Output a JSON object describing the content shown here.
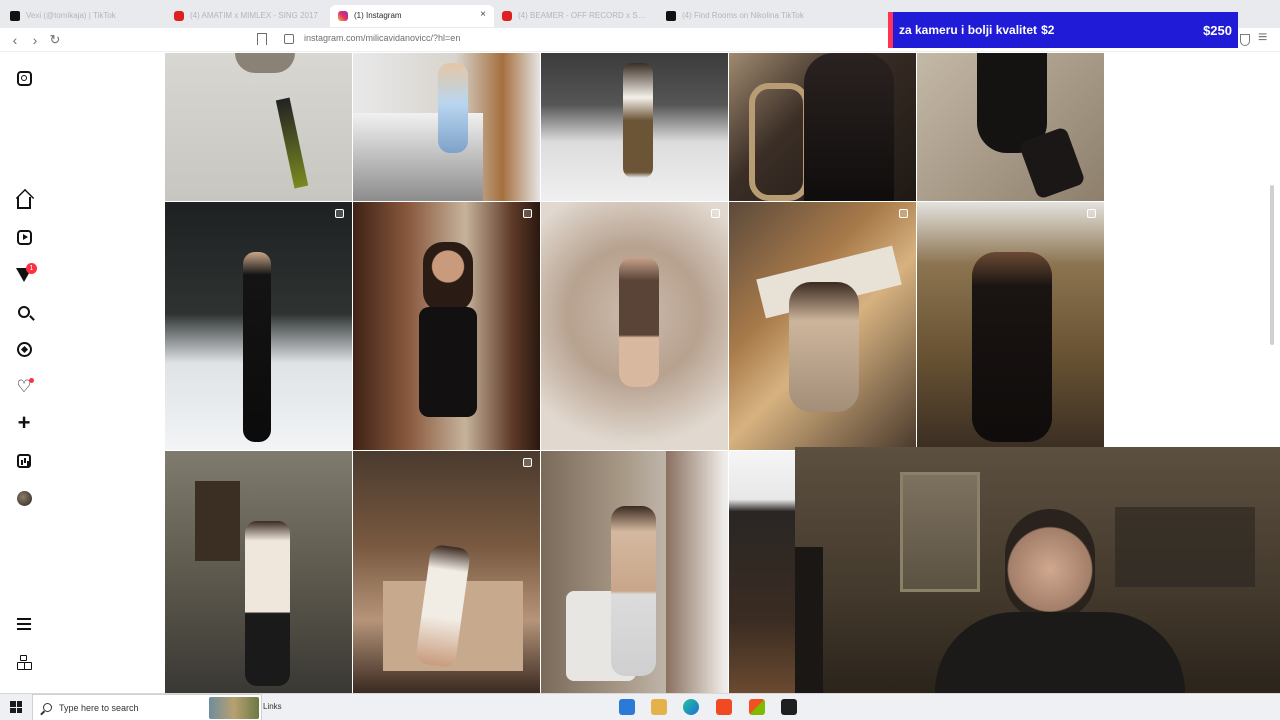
{
  "browser": {
    "tabs": [
      {
        "title": "Vexi (@tomikaja) | TikTok",
        "favicon": "tiktok-icon",
        "active": false
      },
      {
        "title": "(4) AMATIM x MIMLEX - SING 2017",
        "favicon": "youtube-icon",
        "active": false
      },
      {
        "title": "(1) Instagram",
        "favicon": "instagram-icon",
        "active": true
      },
      {
        "title": "(4) BEAMER - OFF RECORD x SCORE",
        "favicon": "youtube-icon",
        "active": false
      },
      {
        "title": "(4) Find Rooms on Nikolina TikTok",
        "favicon": "tiktok-icon",
        "active": false
      }
    ],
    "close_glyph": "×",
    "url": "instagram.com/milicavidanovicc/?hl=en",
    "back_glyph": "‹",
    "forward_glyph": "›",
    "reload_glyph": "↻",
    "menu_glyph": "≡"
  },
  "donation": {
    "message": "za kameru i bolji kvalitet",
    "inline_amount": "$2",
    "total": "$250",
    "color": "#1f1bd6"
  },
  "ig_sidebar": {
    "icons": [
      "instagram-logo-icon",
      "home-icon",
      "reels-icon",
      "messages-icon",
      "search-icon",
      "explore-icon",
      "notifications-icon",
      "create-icon",
      "dashboard-icon",
      "profile-avatar",
      "more-menu-icon",
      "threads-icon"
    ],
    "messages_badge": "1",
    "create_glyph": "+",
    "heart_glyph": "♡"
  },
  "grid": {
    "rows": 3,
    "columns": 5,
    "multi_post_icon": "carousel-icon"
  },
  "taskbar": {
    "search_placeholder": "Type here to search",
    "links_label": "Links"
  }
}
